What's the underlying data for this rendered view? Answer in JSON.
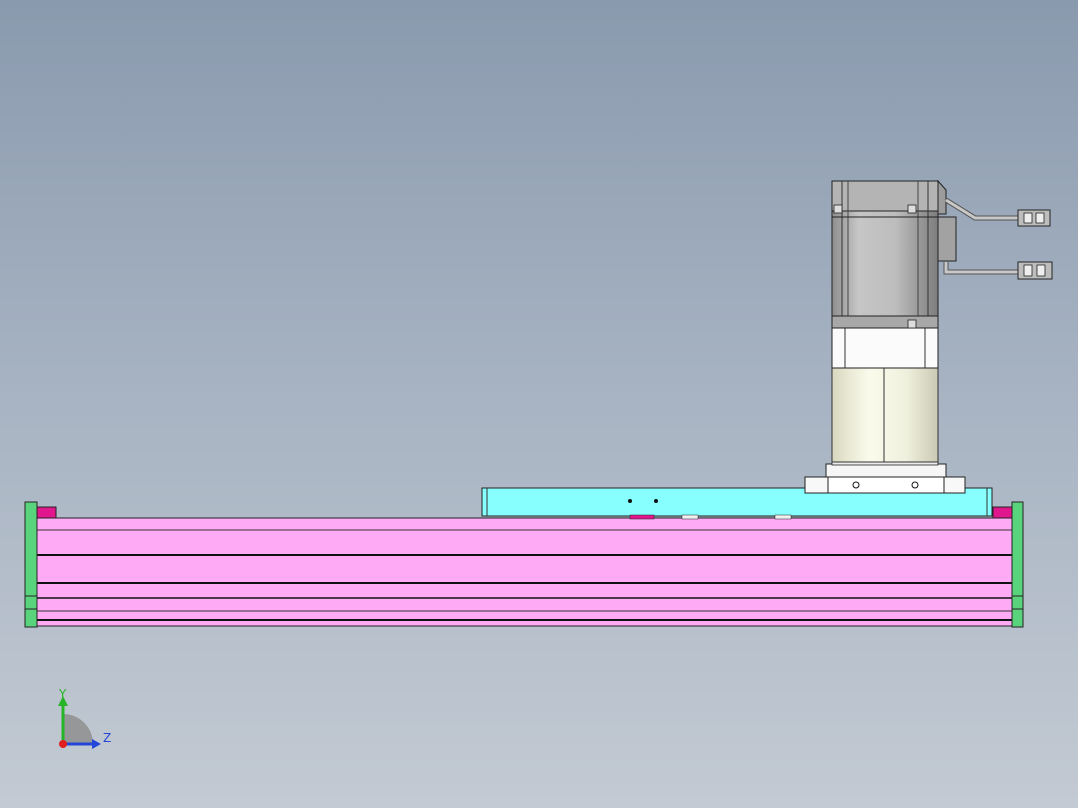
{
  "viewport": {
    "background_top": "#8a9aae",
    "background_bottom": "#c3cad3"
  },
  "colors": {
    "rail_body": "#ffaaf5",
    "rail_groove": "#1a1a1a",
    "rail_highlight": "#e0178c",
    "end_cap": "#59d47d",
    "carriage_plate": "#88ffff",
    "motor_body": "#b8b8b8",
    "flange": "#f4f4f4",
    "reducer": "#eeeedc"
  },
  "triad": {
    "y_label": "Y",
    "z_label": "Z",
    "y_color": "#28b428",
    "z_color": "#2446d8",
    "origin_color": "#e02020"
  }
}
